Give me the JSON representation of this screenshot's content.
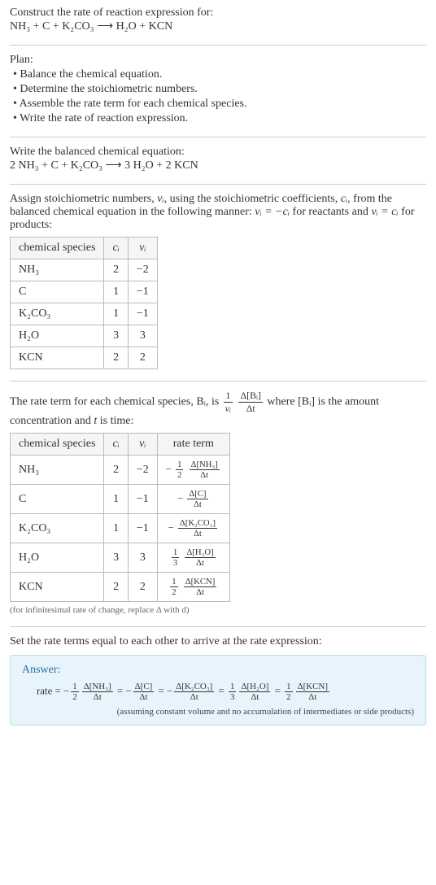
{
  "title": "Construct the rate of reaction expression for:",
  "unbalanced": "NH₃ + C + K₂CO₃  ⟶  H₂O + KCN",
  "plan_heading": "Plan:",
  "plan": [
    "• Balance the chemical equation.",
    "• Determine the stoichiometric numbers.",
    "• Assemble the rate term for each chemical species.",
    "• Write the rate of reaction expression."
  ],
  "balanced_heading": "Write the balanced chemical equation:",
  "balanced": "2 NH₃ + C + K₂CO₃  ⟶  3 H₂O + 2 KCN",
  "stoich_intro_a": "Assign stoichiometric numbers, ",
  "stoich_intro_nu": "νᵢ",
  "stoich_intro_b": ", using the stoichiometric coefficients, ",
  "stoich_intro_c": "cᵢ",
  "stoich_intro_d": ", from the balanced chemical equation in the following manner: ",
  "stoich_rule1": "νᵢ = −cᵢ",
  "stoich_intro_e": " for reactants and ",
  "stoich_rule2": "νᵢ = cᵢ",
  "stoich_intro_f": " for products:",
  "table1": {
    "headers": [
      "chemical species",
      "cᵢ",
      "νᵢ"
    ],
    "rows": [
      {
        "species": "NH₃",
        "c": "2",
        "nu": "−2"
      },
      {
        "species": "C",
        "c": "1",
        "nu": "−1"
      },
      {
        "species": "K₂CO₃",
        "c": "1",
        "nu": "−1"
      },
      {
        "species": "H₂O",
        "c": "3",
        "nu": "3"
      },
      {
        "species": "KCN",
        "c": "2",
        "nu": "2"
      }
    ]
  },
  "rate_intro_a": "The rate term for each chemical species, Bᵢ, is ",
  "rate_intro_b": " where [Bᵢ] is the amount concentration and ",
  "rate_intro_t": "t",
  "rate_intro_c": " is time:",
  "rate_frac1_num": "1",
  "rate_frac1_den": "νᵢ",
  "rate_frac2_num": "Δ[Bᵢ]",
  "rate_frac2_den": "Δt",
  "table2": {
    "headers": [
      "chemical species",
      "cᵢ",
      "νᵢ",
      "rate term"
    ],
    "rows": [
      {
        "species": "NH₃",
        "c": "2",
        "nu": "−2",
        "sign": "−",
        "coef_num": "1",
        "coef_den": "2",
        "delta": "Δ[NH₃]"
      },
      {
        "species": "C",
        "c": "1",
        "nu": "−1",
        "sign": "−",
        "coef_num": "",
        "coef_den": "",
        "delta": "Δ[C]"
      },
      {
        "species": "K₂CO₃",
        "c": "1",
        "nu": "−1",
        "sign": "−",
        "coef_num": "",
        "coef_den": "",
        "delta": "Δ[K₂CO₃]"
      },
      {
        "species": "H₂O",
        "c": "3",
        "nu": "3",
        "sign": "",
        "coef_num": "1",
        "coef_den": "3",
        "delta": "Δ[H₂O]"
      },
      {
        "species": "KCN",
        "c": "2",
        "nu": "2",
        "sign": "",
        "coef_num": "1",
        "coef_den": "2",
        "delta": "Δ[KCN]"
      }
    ]
  },
  "dt": "Δt",
  "footnote": "(for infinitesimal rate of change, replace Δ with d)",
  "final_intro": "Set the rate terms equal to each other to arrive at the rate expression:",
  "answer_label": "Answer:",
  "answer_eq": "rate = −½ Δ[NH₃]/Δt = −Δ[C]/Δt = −Δ[K₂CO₃]/Δt = ⅓ Δ[H₂O]/Δt = ½ Δ[KCN]/Δt",
  "answer_note": "(assuming constant volume and no accumulation of intermediates or side products)",
  "chart_data": {
    "type": "table",
    "title": "Stoichiometric numbers and rate terms",
    "tables": [
      {
        "columns": [
          "chemical species",
          "c_i",
          "nu_i"
        ],
        "rows": [
          [
            "NH3",
            2,
            -2
          ],
          [
            "C",
            1,
            -1
          ],
          [
            "K2CO3",
            1,
            -1
          ],
          [
            "H2O",
            3,
            3
          ],
          [
            "KCN",
            2,
            2
          ]
        ]
      },
      {
        "columns": [
          "chemical species",
          "c_i",
          "nu_i",
          "rate term"
        ],
        "rows": [
          [
            "NH3",
            2,
            -2,
            "-(1/2) d[NH3]/dt"
          ],
          [
            "C",
            1,
            -1,
            "- d[C]/dt"
          ],
          [
            "K2CO3",
            1,
            -1,
            "- d[K2CO3]/dt"
          ],
          [
            "H2O",
            3,
            3,
            "(1/3) d[H2O]/dt"
          ],
          [
            "KCN",
            2,
            2,
            "(1/2) d[KCN]/dt"
          ]
        ]
      }
    ]
  }
}
